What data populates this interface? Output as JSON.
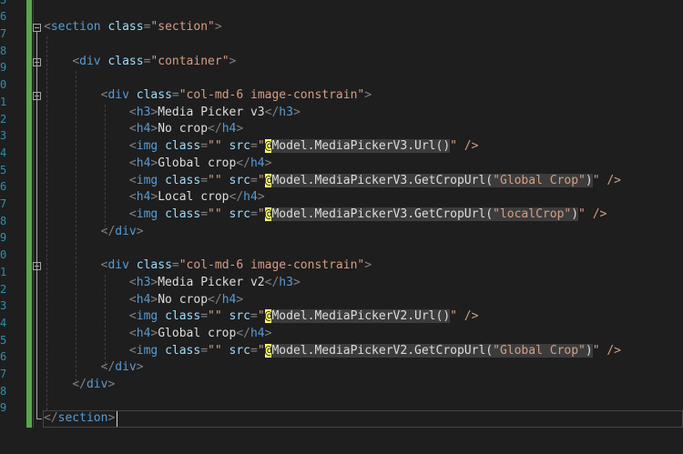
{
  "line_numbers": [
    "5",
    "6",
    "7",
    "8",
    "9",
    "0",
    "1",
    "2",
    "3",
    "4",
    "5",
    "6",
    "7",
    "8",
    "9",
    "0",
    "1",
    "2",
    "3",
    "4",
    "5",
    "6",
    "7",
    "8",
    "9"
  ],
  "code": {
    "section_open": {
      "tag": "section",
      "attr": "class",
      "value": "\"section\""
    },
    "container_open": {
      "tag": "div",
      "attr": "class",
      "value": "\"container\""
    },
    "col1_open": {
      "tag": "div",
      "attr": "class",
      "value": "\"col-md-6 image-constrain\""
    },
    "h3_v3": {
      "tag": "h3",
      "text": "Media Picker v3"
    },
    "h4_nocrop1": {
      "tag": "h4",
      "text": "No crop"
    },
    "img1": {
      "tag": "img",
      "attr1": "class",
      "val1": "\"\"",
      "attr2": "src",
      "q": "\"",
      "at": "@",
      "expr": "Model.MediaPickerV3.Url()",
      "close": "\" />"
    },
    "h4_global1": {
      "tag": "h4",
      "text": "Global crop"
    },
    "img2": {
      "tag": "img",
      "attr1": "class",
      "val1": "\"\"",
      "attr2": "src",
      "q": "\"",
      "at": "@",
      "expr_a": "Model.MediaPickerV3.GetCropUrl(",
      "arg": "\"Global Crop\"",
      "expr_b": ")",
      "close": "\" />"
    },
    "h4_local": {
      "tag": "h4",
      "text": "Local crop"
    },
    "img3": {
      "tag": "img",
      "attr1": "class",
      "val1": "\"\"",
      "attr2": "src",
      "q": "\"",
      "at": "@",
      "expr_a": "Model.MediaPickerV3.GetCropUrl(",
      "arg": "\"localCrop\"",
      "expr_b": ")",
      "close": "\" />"
    },
    "div_close1": {
      "tag": "div"
    },
    "col2_open": {
      "tag": "div",
      "attr": "class",
      "value": "\"col-md-6 image-constrain\""
    },
    "h3_v2": {
      "tag": "h3",
      "text": "Media Picker v2"
    },
    "h4_nocrop2": {
      "tag": "h4",
      "text": "No crop"
    },
    "img4": {
      "tag": "img",
      "attr1": "class",
      "val1": "\"\"",
      "attr2": "src",
      "q": "\"",
      "at": "@",
      "expr": "Model.MediaPickerV2.Url()",
      "close": "\" />"
    },
    "h4_global2": {
      "tag": "h4",
      "text": "Global crop"
    },
    "img5": {
      "tag": "img",
      "attr1": "class",
      "val1": "\"\"",
      "attr2": "src",
      "q": "\"",
      "at": "@",
      "expr_a": "Model.MediaPickerV2.GetCropUrl(",
      "arg": "\"Global Crop\"",
      "expr_b": ")",
      "close": "\" />"
    },
    "div_close2": {
      "tag": "div"
    },
    "div_close3": {
      "tag": "div"
    },
    "section_close": {
      "tag": "section"
    }
  },
  "colors": {
    "background": "#1e1e1e",
    "tag": "#569cd6",
    "attribute": "#9cdcfe",
    "string": "#d69d85",
    "razor_at": "#ffff66",
    "change_bar": "#57a64a",
    "line_number": "#2b91af"
  }
}
